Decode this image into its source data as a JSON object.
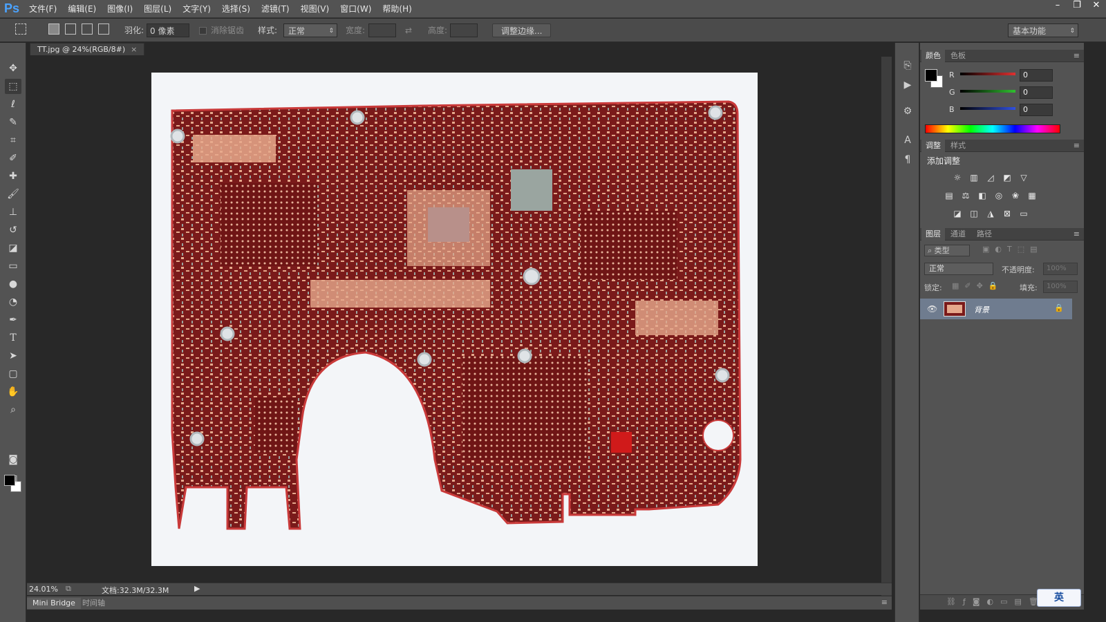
{
  "app": {
    "logo": "Ps"
  },
  "menu": [
    "文件(F)",
    "编辑(E)",
    "图像(I)",
    "图层(L)",
    "文字(Y)",
    "选择(S)",
    "滤镜(T)",
    "视图(V)",
    "窗口(W)",
    "帮助(H)"
  ],
  "window_controls": {
    "minimize": "–",
    "restore": "❐",
    "close": "✕"
  },
  "options": {
    "feather_label": "羽化:",
    "feather_value": "0 像素",
    "antialias_label": "消除锯齿",
    "style_label": "样式:",
    "style_value": "正常",
    "width_label": "宽度:",
    "height_label": "高度:",
    "refine_edge_button": "调整边缘...",
    "workspace": "基本功能"
  },
  "document": {
    "tab_title": "TT.jpg @ 24%(RGB/8#)",
    "tab_close": "×",
    "zoom": "24.01%",
    "doc_info": "文档:32.3M/32.3M"
  },
  "bottom_tabs": [
    "Mini Bridge",
    "时间轴"
  ],
  "color_panel": {
    "tabs": [
      "颜色",
      "色板"
    ],
    "channels": [
      {
        "label": "R",
        "value": "0",
        "color": "#e03030"
      },
      {
        "label": "G",
        "value": "0",
        "color": "#30c030"
      },
      {
        "label": "B",
        "value": "0",
        "color": "#3050e0"
      }
    ]
  },
  "adjust_panel": {
    "tabs": [
      "调整",
      "样式"
    ],
    "title": "添加调整"
  },
  "layers_panel": {
    "tabs": [
      "图层",
      "通道",
      "路径"
    ],
    "filter_kind": "类型",
    "blend_mode": "正常",
    "opacity_label": "不透明度:",
    "opacity_value": "100%",
    "lock_label": "锁定:",
    "fill_label": "填充:",
    "fill_value": "100%",
    "layers": [
      {
        "name": "背景",
        "visible": true,
        "locked": true
      }
    ]
  },
  "ime": {
    "label": "英"
  },
  "colors": {
    "pcb_red": "#7a1a1a",
    "pcb_copper": "#e6a98c",
    "layer_highlight": "#6f7c8f"
  }
}
